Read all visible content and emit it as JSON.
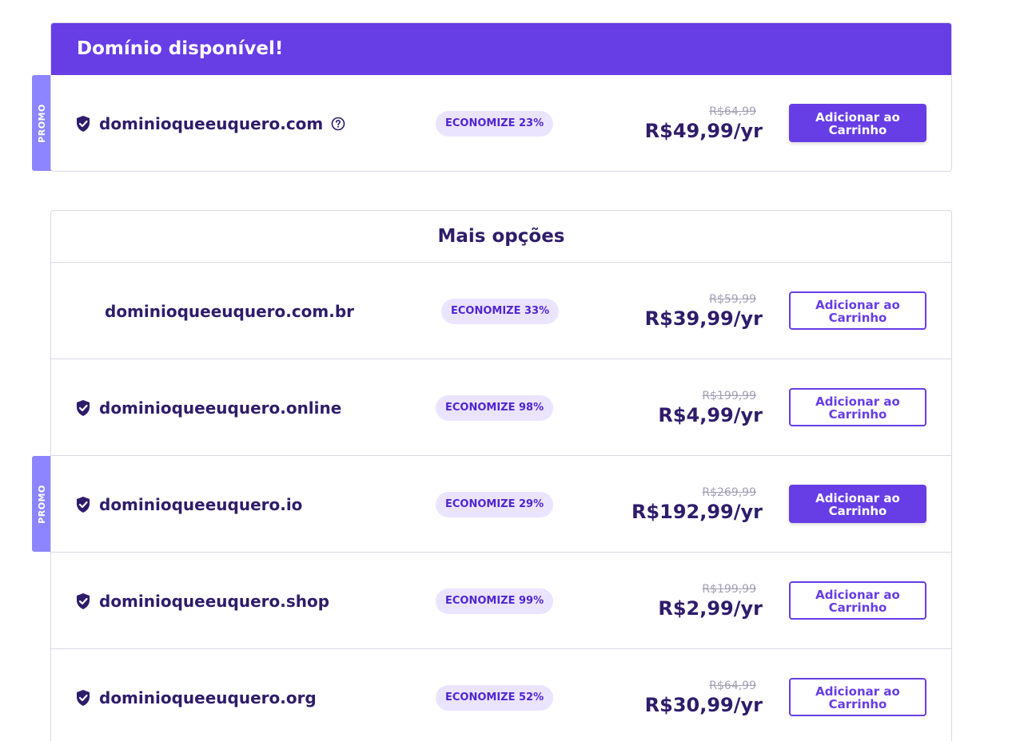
{
  "available": {
    "title": "Domínio disponível!",
    "promo_label": "PROMO",
    "domain": "dominioqueeuquero.com",
    "badge": "ECONOMIZE 23%",
    "old_price": "R$64,99",
    "price": "R$49,99/yr",
    "button": "Adicionar ao Carrinho"
  },
  "more": {
    "title": "Mais opções",
    "promo_label": "PROMO",
    "items": [
      {
        "domain": "dominioqueeuquero.com.br",
        "badge": "ECONOMIZE 33%",
        "old_price": "R$59,99",
        "price": "R$39,99/yr",
        "button": "Adicionar ao Carrinho"
      },
      {
        "domain": "dominioqueeuquero.online",
        "badge": "ECONOMIZE 98%",
        "old_price": "R$199,99",
        "price": "R$4,99/yr",
        "button": "Adicionar ao Carrinho"
      },
      {
        "domain": "dominioqueeuquero.io",
        "badge": "ECONOMIZE 29%",
        "old_price": "R$269,99",
        "price": "R$192,99/yr",
        "button": "Adicionar ao Carrinho"
      },
      {
        "domain": "dominioqueeuquero.shop",
        "badge": "ECONOMIZE 99%",
        "old_price": "R$199,99",
        "price": "R$2,99/yr",
        "button": "Adicionar ao Carrinho"
      },
      {
        "domain": "dominioqueeuquero.org",
        "badge": "ECONOMIZE 52%",
        "old_price": "R$64,99",
        "price": "R$30,99/yr",
        "button": "Adicionar ao Carrinho"
      }
    ]
  },
  "colors": {
    "brand": "#673de6",
    "promo": "#8c85ff",
    "badge_bg": "#ebe4ff",
    "text": "#2f1c6a"
  },
  "icons": {
    "verified": "shield-check-icon",
    "help": "help-circle-icon"
  }
}
